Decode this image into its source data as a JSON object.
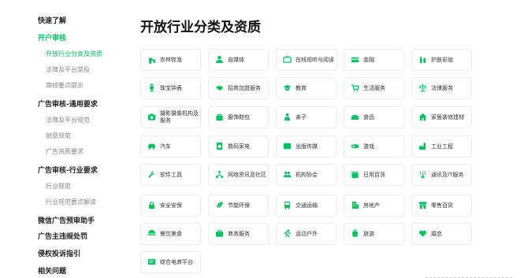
{
  "sidebar": {
    "items": [
      {
        "label": "快速了解",
        "level": 1,
        "active": false
      },
      {
        "label": "开户审核",
        "level": 1,
        "active": true
      },
      {
        "label": "开放行业分类及资质",
        "level": 2,
        "active": true
      },
      {
        "label": "法律及平台禁投",
        "level": 2,
        "active": false
      },
      {
        "label": "审核要点提示",
        "level": 2,
        "active": false
      },
      {
        "label": "广告审核-通用要求",
        "level": 1,
        "active": false
      },
      {
        "label": "法律及平台规范",
        "level": 2,
        "active": false
      },
      {
        "label": "创意规范",
        "level": 2,
        "active": false
      },
      {
        "label": "广告资质要求",
        "level": 2,
        "active": false
      },
      {
        "label": "广告审核-行业要求",
        "level": 1,
        "active": false
      },
      {
        "label": "行业规范",
        "level": 2,
        "active": false
      },
      {
        "label": "行业规范要点解读",
        "level": 2,
        "active": false
      },
      {
        "label": "微信广告预审助手",
        "level": 1,
        "active": false
      },
      {
        "label": "广告主违规处罚",
        "level": 1,
        "active": false
      },
      {
        "label": "侵权投诉指引",
        "level": 1,
        "active": false
      },
      {
        "label": "相关问题",
        "level": 1,
        "active": false
      }
    ]
  },
  "main": {
    "title": "开放行业分类及资质",
    "accent_color": "#07c160",
    "industries": [
      {
        "label": "农林牧渔",
        "icon": "tractor-icon"
      },
      {
        "label": "自媒体",
        "icon": "person-icon"
      },
      {
        "label": "在线视听与阅读",
        "icon": "tv-icon"
      },
      {
        "label": "金融",
        "icon": "card-icon"
      },
      {
        "label": "护肤彩妆",
        "icon": "cosmetics-icon"
      },
      {
        "label": "珠宝钟表",
        "icon": "watch-icon"
      },
      {
        "label": "招商加盟服务",
        "icon": "handshake-icon"
      },
      {
        "label": "教育",
        "icon": "graduation-cap-icon"
      },
      {
        "label": "生活服务",
        "icon": "cart-icon"
      },
      {
        "label": "法律服务",
        "icon": "scales-icon"
      },
      {
        "label": "摄影摄像机构及服务",
        "icon": "camera-icon"
      },
      {
        "label": "服饰鞋包",
        "icon": "bag-icon"
      },
      {
        "label": "亲子",
        "icon": "baby-icon"
      },
      {
        "label": "食品",
        "icon": "food-icon"
      },
      {
        "label": "家居装修建材",
        "icon": "home-icon"
      },
      {
        "label": "汽车",
        "icon": "car-icon"
      },
      {
        "label": "数码家电",
        "icon": "appliance-icon"
      },
      {
        "label": "出版传媒",
        "icon": "book-icon"
      },
      {
        "label": "游戏",
        "icon": "gamepad-icon"
      },
      {
        "label": "工业工程",
        "icon": "factory-icon"
      },
      {
        "label": "软件工具",
        "icon": "wrench-icon"
      },
      {
        "label": "网络资讯及社区",
        "icon": "network-icon"
      },
      {
        "label": "机构协会",
        "icon": "group-icon"
      },
      {
        "label": "日用百货",
        "icon": "box-icon"
      },
      {
        "label": "通讯及IT服务",
        "icon": "antenna-icon"
      },
      {
        "label": "安全安保",
        "icon": "lock-icon"
      },
      {
        "label": "节能环保",
        "icon": "leaf-icon"
      },
      {
        "label": "交通运输",
        "icon": "bus-icon"
      },
      {
        "label": "房地产",
        "icon": "building-icon"
      },
      {
        "label": "零售百货",
        "icon": "store-icon"
      },
      {
        "label": "餐饮美食",
        "icon": "dining-icon"
      },
      {
        "label": "商务服务",
        "icon": "briefcase-icon"
      },
      {
        "label": "运动户外",
        "icon": "running-icon"
      },
      {
        "label": "旅游",
        "icon": "luggage-icon"
      },
      {
        "label": "婚恋",
        "icon": "heart-icon"
      },
      {
        "label": "综合电商平台",
        "icon": "shop-icon"
      }
    ]
  }
}
